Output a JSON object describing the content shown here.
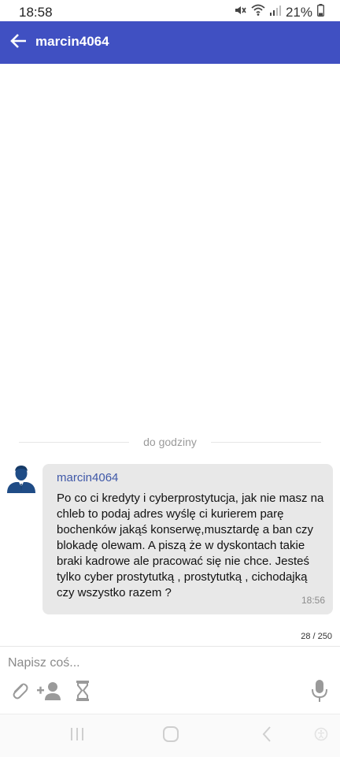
{
  "status_bar": {
    "time": "18:58",
    "battery": "21%"
  },
  "app_bar": {
    "title": "marcin4064",
    "color": "#4050c2"
  },
  "divider": {
    "label": "do godziny"
  },
  "message": {
    "sender": "marcin4064",
    "text": "Po co ci kredyty i cyberprostytucja, jak nie masz na chleb to podaj adres wyślę ci kurierem parę bochenków jakąś konserwę,musztardę a ban czy blokadę olewam. A piszą że w dyskontach takie braki kadrowe ale pracować się nie chce. Jesteś tylko cyber prostytutką , prostytutką , cichodajką czy wszystko razem ?",
    "time": "18:56",
    "bubble_color": "#e8e8e8",
    "sender_color": "#3f58a8"
  },
  "composer": {
    "counter": "28 / 250",
    "placeholder": "Napisz coś...",
    "value": ""
  },
  "icons": {
    "back": "arrow-left-icon",
    "mute": "mute-icon",
    "wifi": "wifi-icon",
    "signal": "signal-icon",
    "battery": "battery-icon",
    "avatar": "user-avatar-icon",
    "attach": "paperclip-icon",
    "add_user": "add-user-icon",
    "hourglass": "hourglass-icon",
    "mic": "microphone-icon",
    "recents": "recents-icon",
    "home": "home-icon",
    "nav_back": "nav-back-icon",
    "accessibility": "accessibility-icon"
  }
}
